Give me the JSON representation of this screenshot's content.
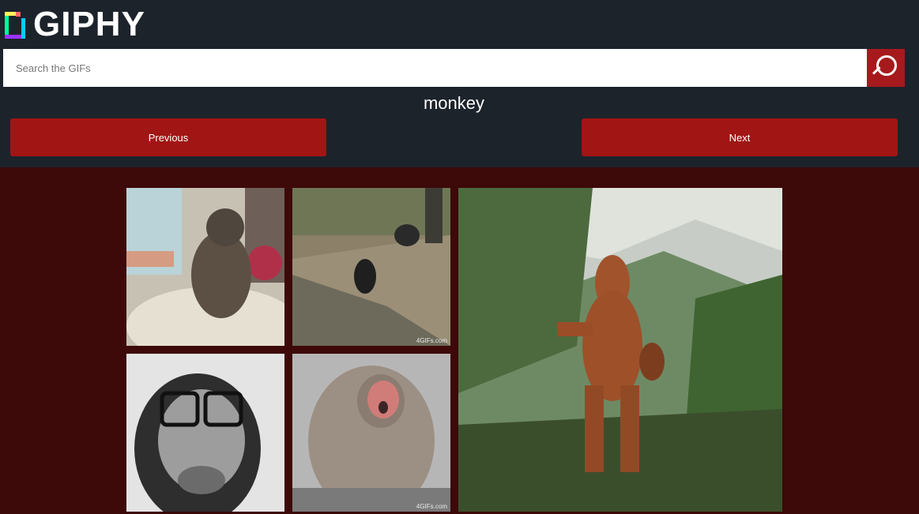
{
  "brand": {
    "name": "GIPHY",
    "logo_icon": "giphy-logo-icon"
  },
  "search": {
    "placeholder": "Search the GIFs",
    "value": "",
    "button_icon": "search-icon"
  },
  "query": {
    "term": "monkey"
  },
  "nav": {
    "previous_label": "Previous",
    "next_label": "Next"
  },
  "results": [
    {
      "subject": "monkey-bath-gif",
      "watermark": ""
    },
    {
      "subject": "monkeys-river-gif",
      "watermark": "4GIFs.com"
    },
    {
      "subject": "dancing-orangutan-gif",
      "watermark": ""
    },
    {
      "subject": "monkey-glasses-gif",
      "watermark": ""
    },
    {
      "subject": "snow-monkey-gif",
      "watermark": "4GIFs.com"
    }
  ],
  "colors": {
    "header_bg": "#1c232b",
    "results_bg": "#3d0909",
    "accent": "#a21515"
  }
}
